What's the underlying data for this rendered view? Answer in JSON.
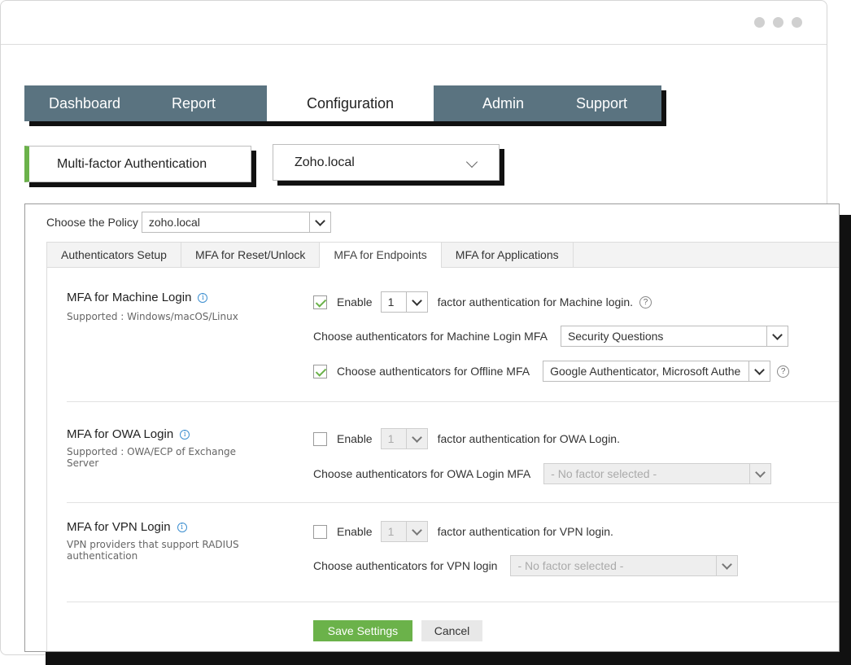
{
  "nav": {
    "items": [
      {
        "label": "Dashboard",
        "active": false
      },
      {
        "label": "Report",
        "active": false
      },
      {
        "label": "Configuration",
        "active": true
      },
      {
        "label": "Admin",
        "active": false
      },
      {
        "label": "Support",
        "active": false
      }
    ]
  },
  "sub": {
    "module_label": "Multi-factor Authentication",
    "domain_label": "Zoho.local"
  },
  "policy": {
    "label": "Choose the Policy",
    "value": "zoho.local"
  },
  "tabs": [
    {
      "label": "Authenticators Setup",
      "active": false
    },
    {
      "label": "MFA for Reset/Unlock",
      "active": false
    },
    {
      "label": "MFA for Endpoints",
      "active": true
    },
    {
      "label": "MFA for Applications",
      "active": false
    }
  ],
  "machine": {
    "title": "MFA for Machine Login",
    "subtitle": "Supported : Windows/macOS/Linux",
    "enable_label": "Enable",
    "enable_checked": true,
    "factor_count": "1",
    "factor_text": "factor authentication for Machine login.",
    "choose_label": "Choose authenticators for Machine Login MFA",
    "choose_value": "Security Questions",
    "offline_checked": true,
    "offline_label": "Choose authenticators for Offline MFA",
    "offline_value": "Google Authenticator, Microsoft Authe"
  },
  "owa": {
    "title": "MFA for OWA Login",
    "subtitle": "Supported : OWA/ECP of Exchange Server",
    "enable_label": "Enable",
    "enable_checked": false,
    "factor_count": "1",
    "factor_text": "factor authentication for OWA Login.",
    "choose_label": "Choose authenticators for OWA Login MFA",
    "choose_value": "- No factor selected -"
  },
  "vpn": {
    "title": "MFA for VPN Login",
    "subtitle": "VPN providers that support RADIUS authentication",
    "enable_label": "Enable",
    "enable_checked": false,
    "factor_count": "1",
    "factor_text": "factor authentication for VPN login.",
    "choose_label": "Choose authenticators for VPN login",
    "choose_value": "- No factor selected -"
  },
  "actions": {
    "save_label": "Save Settings",
    "cancel_label": "Cancel"
  },
  "colors": {
    "nav_bg": "#5a7380",
    "accent_green": "#6bb24a",
    "info_blue": "#3d8fd0"
  }
}
